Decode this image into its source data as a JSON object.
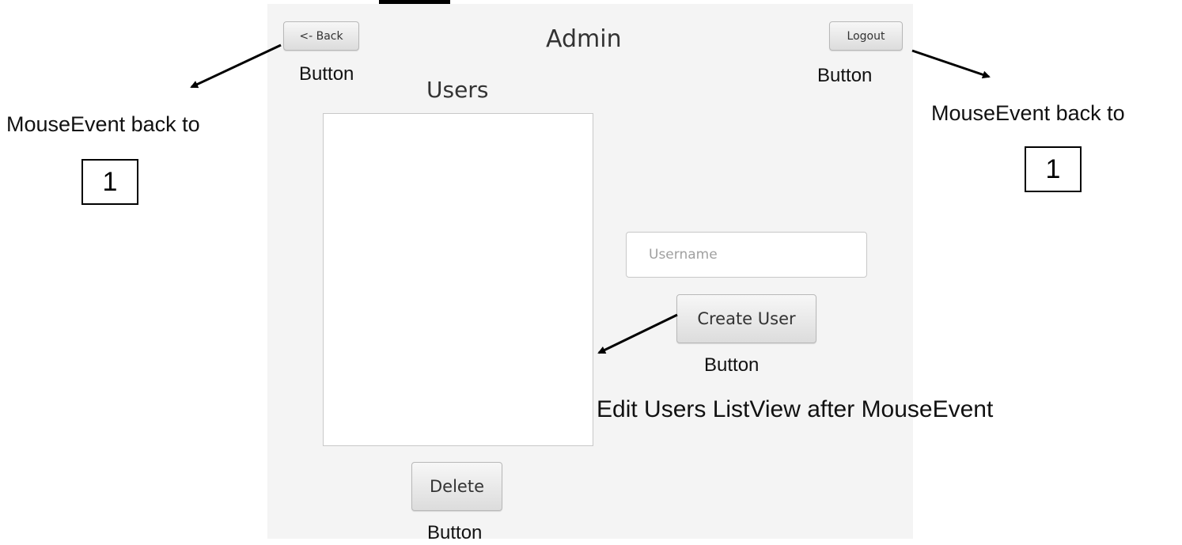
{
  "window": {
    "title": "Admin",
    "back_button": "<- Back",
    "logout_button": "Logout",
    "users_label": "Users",
    "username_placeholder": "Username",
    "create_user_button": "Create User",
    "delete_button": "Delete"
  },
  "annotations": {
    "back_type": "Button",
    "logout_type": "Button",
    "create_type": "Button",
    "delete_type": "Button",
    "left_event": "MouseEvent back to",
    "right_event": "MouseEvent back to",
    "left_target": "1",
    "right_target": "1",
    "create_note": "Edit Users ListView after MouseEvent"
  }
}
